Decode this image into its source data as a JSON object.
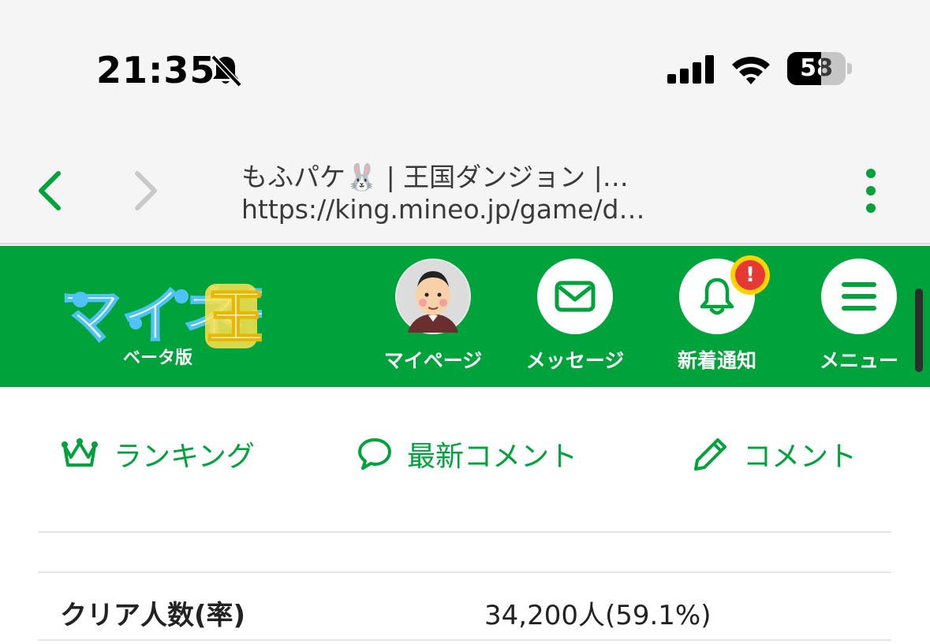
{
  "status": {
    "time": "21:35",
    "battery_level": 58,
    "battery_label": "58"
  },
  "browser": {
    "title": "もふパケ🐰 | 王国ダンジョン |…",
    "url": "https://king.mineo.jp/game/d…"
  },
  "header": {
    "logo_text": "マイネ王",
    "beta_label": "ベータ版",
    "items": [
      {
        "label": "マイページ"
      },
      {
        "label": "メッセージ"
      },
      {
        "label": "新着通知",
        "badge": "!"
      },
      {
        "label": "メニュー"
      }
    ]
  },
  "tabs": [
    {
      "label": "ランキング",
      "icon": "crown-icon"
    },
    {
      "label": "最新コメント",
      "icon": "speech-bubble-icon"
    },
    {
      "label": "コメント",
      "icon": "pencil-icon"
    }
  ],
  "stats": {
    "rows": [
      {
        "label": "クリア人数(率)",
        "value": "34,200人(59.1%)"
      }
    ]
  },
  "colors": {
    "brand_green": "#00a23c",
    "badge_red": "#e53935",
    "badge_yellow": "#ffd200"
  }
}
